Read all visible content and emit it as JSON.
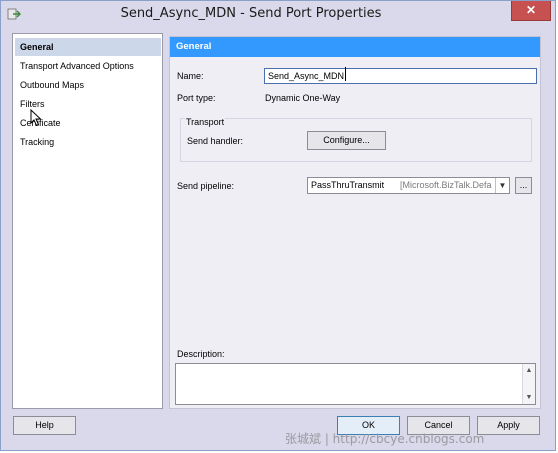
{
  "window": {
    "title": "Send_Async_MDN - Send Port Properties",
    "close_label": "✕"
  },
  "nav": {
    "items": [
      {
        "label": "General",
        "selected": true
      },
      {
        "label": "Transport Advanced Options",
        "selected": false
      },
      {
        "label": "Outbound Maps",
        "selected": false
      },
      {
        "label": "Filters",
        "selected": false
      },
      {
        "label": "Certificate",
        "selected": false
      },
      {
        "label": "Tracking",
        "selected": false
      }
    ]
  },
  "general": {
    "header": "General",
    "name_label": "Name:",
    "name_value": "Send_Async_MDN",
    "port_type_label": "Port type:",
    "port_type_value": "Dynamic One-Way",
    "transport_group_label": "Transport",
    "send_handler_label": "Send handler:",
    "configure_button": "Configure...",
    "send_pipeline_label": "Send pipeline:",
    "send_pipeline_value": "PassThruTransmit",
    "send_pipeline_assembly": "[Microsoft.BizTalk.Defa",
    "pipeline_browse_button": "...",
    "description_label": "Description:"
  },
  "footer": {
    "help_button": "Help",
    "ok_button": "OK",
    "cancel_button": "Cancel",
    "apply_button": "Apply"
  },
  "watermark": "张城斌 | http://cbcye.cnblogs.com"
}
